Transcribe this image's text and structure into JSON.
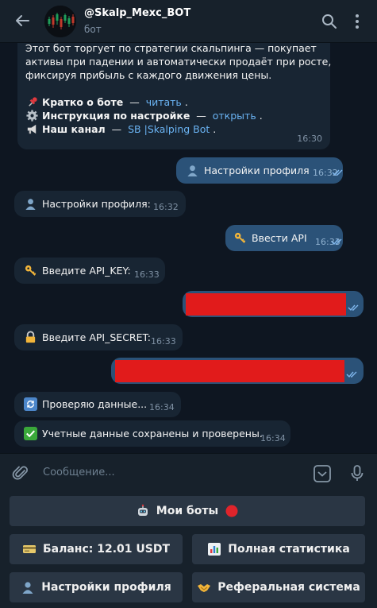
{
  "header": {
    "title": "@Skalp_Mexc_BOT",
    "subtitle": "бот"
  },
  "messages": {
    "intro": {
      "line1": "Этот бот торгует по стратегии скальпинга — покупает",
      "line2": "активы при падении и автоматически продаёт при росте,",
      "line3": "фиксируя прибыль с каждого движения цены.",
      "about_label": "Кратко о боте",
      "about_sep": " — ",
      "about_link": "читать",
      "guide_label": "Инструкция по настройке",
      "guide_sep": " — ",
      "guide_link": "открыть",
      "channel_label": "Наш канал",
      "channel_sep": " — ",
      "channel_link": "SB |Skalping Bot",
      "dot": ".",
      "time": "16:30"
    },
    "m1": {
      "text": "Настройки профиля",
      "time": "16:32"
    },
    "m2": {
      "text": "Настройки профиля:",
      "time": "16:32"
    },
    "m3": {
      "text": "Ввести API",
      "time": "16:33"
    },
    "m4": {
      "text": "Введите API_KEY:",
      "time": "16:33"
    },
    "m6": {
      "text": "Введите API_SECRET:",
      "time": "16:33"
    },
    "m8": {
      "text": "Проверяю данные...",
      "time": "16:34"
    },
    "m9": {
      "text": "Учетные данные сохранены и проверены.",
      "time": "16:34"
    }
  },
  "composer": {
    "placeholder": "Сообщение..."
  },
  "keyboard": {
    "my_bots": "Мои боты",
    "balance": "Баланс: 12.01 USDT",
    "stats": "Полная статистика",
    "profile": "Настройки профиля",
    "referral": "Реферальная система"
  },
  "colors": {
    "background": "#0e1621",
    "panel": "#17212b",
    "incoming": "#182533",
    "outgoing": "#2b5278",
    "link": "#6ab3f3",
    "redaction": "#e11b1b"
  },
  "icons": [
    "back-arrow-icon",
    "search-icon",
    "more-icon",
    "pushpin-icon",
    "gear-icon",
    "megaphone-icon",
    "user-icon",
    "key-icon",
    "lock-icon",
    "refresh-icon",
    "check-icon",
    "paperclip-icon",
    "emoji-icon",
    "mic-icon",
    "robot-icon",
    "red-circle-icon",
    "banknote-icon",
    "chart-icon",
    "handshake-icon"
  ]
}
